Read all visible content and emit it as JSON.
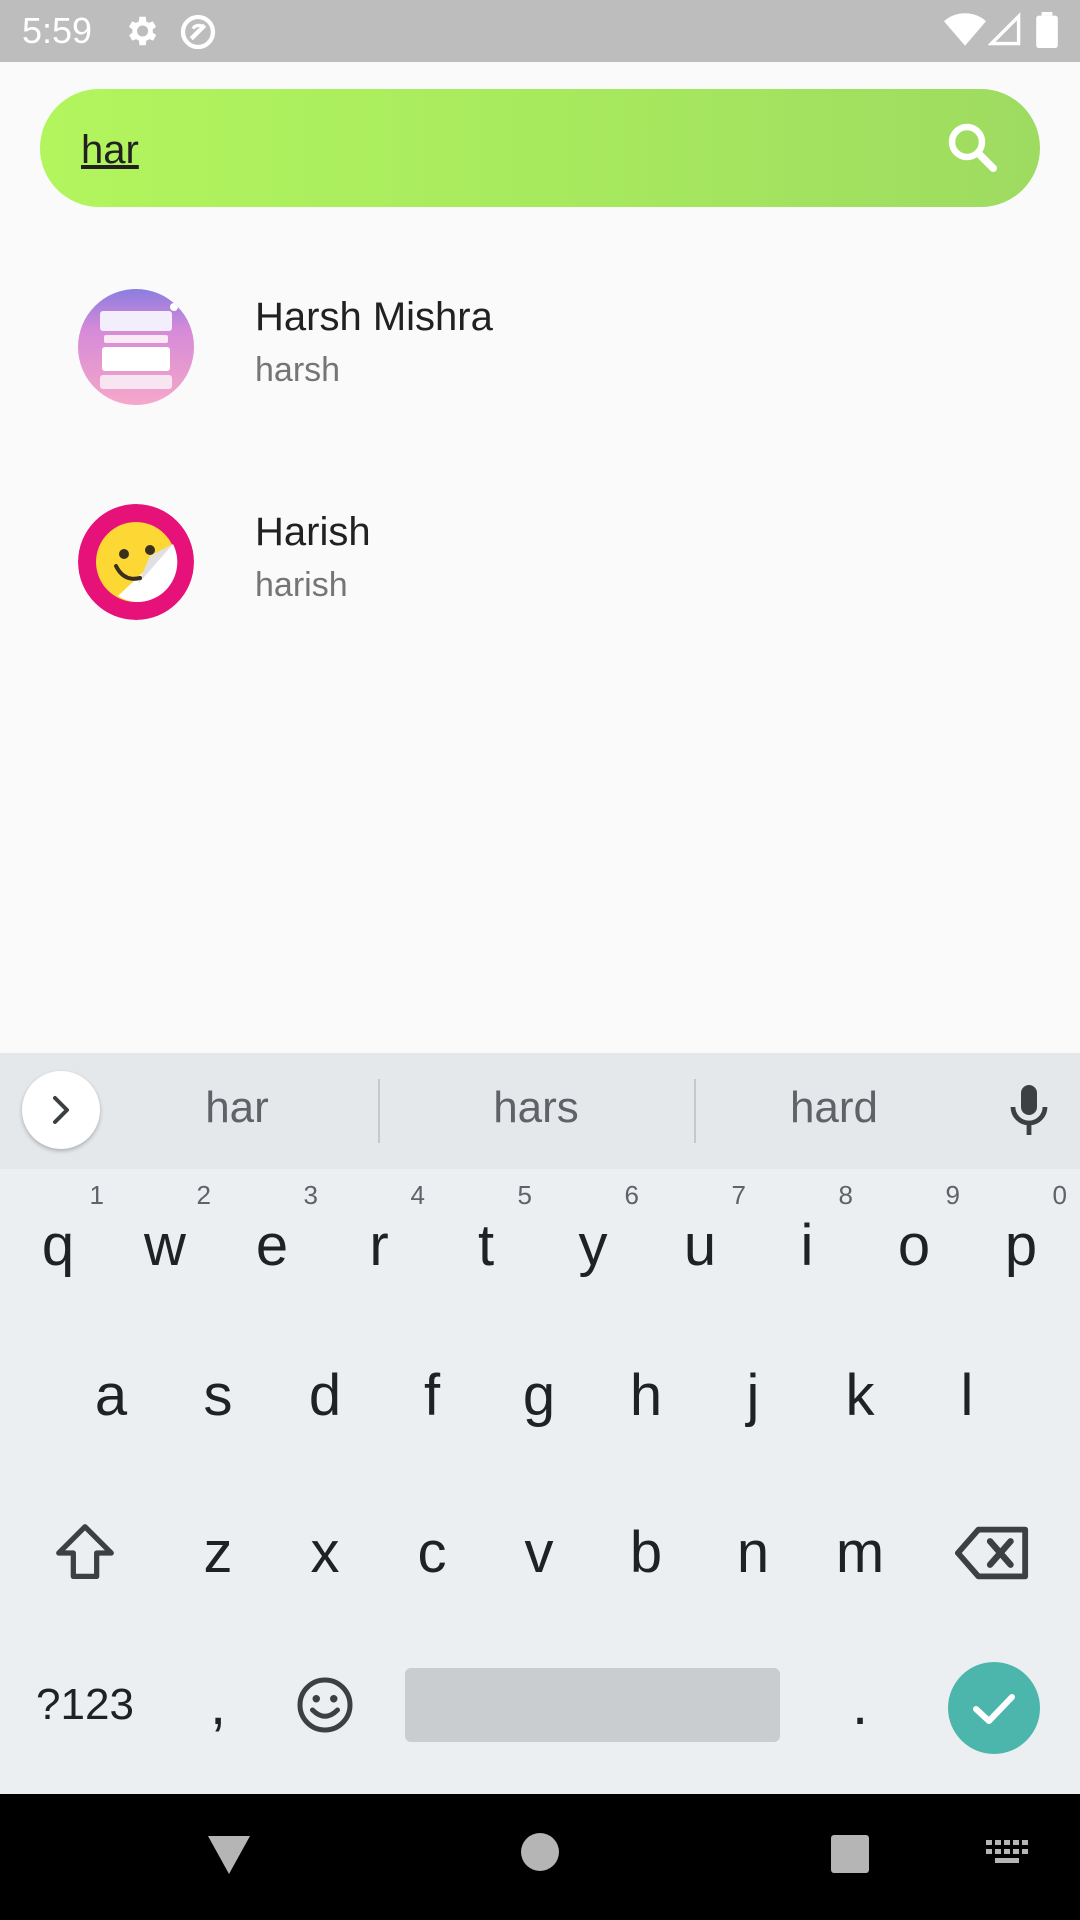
{
  "status_bar": {
    "time": "5:59",
    "icons": [
      "gear-icon",
      "no-data-icon",
      "wifi-icon",
      "signal-icon",
      "battery-icon"
    ]
  },
  "search": {
    "query": "har",
    "icon": "search-icon",
    "bar_color_start": "#b2f55d",
    "bar_color_end": "#9edb61"
  },
  "results": [
    {
      "name": "Harsh Mishra",
      "username": "harsh"
    },
    {
      "name": "Harish",
      "username": "harish"
    }
  ],
  "keyboard": {
    "suggestions": [
      "har",
      "hars",
      "hard"
    ],
    "row1": [
      {
        "key": "q",
        "hint": "1"
      },
      {
        "key": "w",
        "hint": "2"
      },
      {
        "key": "e",
        "hint": "3"
      },
      {
        "key": "r",
        "hint": "4"
      },
      {
        "key": "t",
        "hint": "5"
      },
      {
        "key": "y",
        "hint": "6"
      },
      {
        "key": "u",
        "hint": "7"
      },
      {
        "key": "i",
        "hint": "8"
      },
      {
        "key": "o",
        "hint": "9"
      },
      {
        "key": "p",
        "hint": "0"
      }
    ],
    "row2": [
      "a",
      "s",
      "d",
      "f",
      "g",
      "h",
      "j",
      "k",
      "l"
    ],
    "row3": [
      "z",
      "x",
      "c",
      "v",
      "b",
      "n",
      "m"
    ],
    "symbols_label": "?123",
    "comma": ",",
    "period": ".",
    "enter_color": "#4db6ac"
  },
  "nav_bar": {
    "icons": [
      "back-icon",
      "home-icon",
      "recents-icon",
      "keyboard-switch-icon"
    ]
  }
}
